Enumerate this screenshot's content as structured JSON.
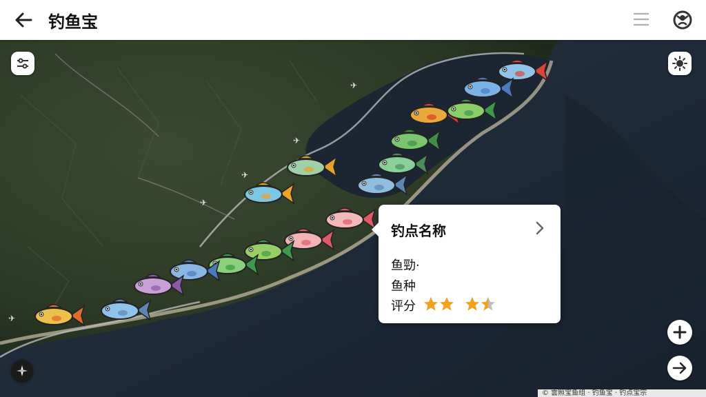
{
  "app": {
    "title": "钓鱼宝"
  },
  "popup": {
    "title": "钓点名称",
    "line1": "鱼勁·",
    "line2": "鱼种",
    "rating_label": "评分",
    "rating_value": 3.5,
    "rating_max": 5
  },
  "attribution": "© 雲照宝鱼组 · 钓鱼宝 · 钓点宝宗",
  "icons": {
    "back": "arrow-left-icon",
    "menu": "hamburger-menu-icon",
    "profile": "profile-icon",
    "filter": "filter-icon",
    "brightness": "brightness-icon",
    "zoom_in": "plus-icon",
    "go": "arrow-right-icon",
    "compass": "compass-icon"
  },
  "colors": {
    "star": "#f2a21a",
    "star_empty": "#bdbdbd"
  },
  "fish_markers": [
    {
      "color": "#8fc3ea",
      "fin": "#d9433a"
    },
    {
      "color": "#7ab4e4",
      "fin": "#4a7bbf"
    },
    {
      "color": "#e9a83a",
      "fin": "#d6402e"
    },
    {
      "color": "#8ccf6a",
      "fin": "#3e9a4a"
    },
    {
      "color": "#7ac56e",
      "fin": "#3d9147"
    },
    {
      "color": "#8ad099",
      "fin": "#4a8e5c"
    },
    {
      "color": "#8fbee0",
      "fin": "#5d86b0"
    },
    {
      "color": "#9fd0a8",
      "fin": "#e2a52a"
    },
    {
      "color": "#7cc7e6",
      "fin": "#f0a426"
    },
    {
      "color": "#f2b9b9",
      "fin": "#e05a6a"
    },
    {
      "color": "#f0b4b4",
      "fin": "#e05a6a"
    },
    {
      "color": "#98cf64",
      "fin": "#3e9a4a"
    },
    {
      "color": "#8bd07a",
      "fin": "#3e9a4a"
    },
    {
      "color": "#8ab6e3",
      "fin": "#4a7bbf"
    },
    {
      "color": "#c9a0d6",
      "fin": "#8a5aa8"
    },
    {
      "color": "#8fc3ea",
      "fin": "#5d86b0"
    },
    {
      "color": "#ecc04a",
      "fin": "#e06b2a"
    }
  ]
}
